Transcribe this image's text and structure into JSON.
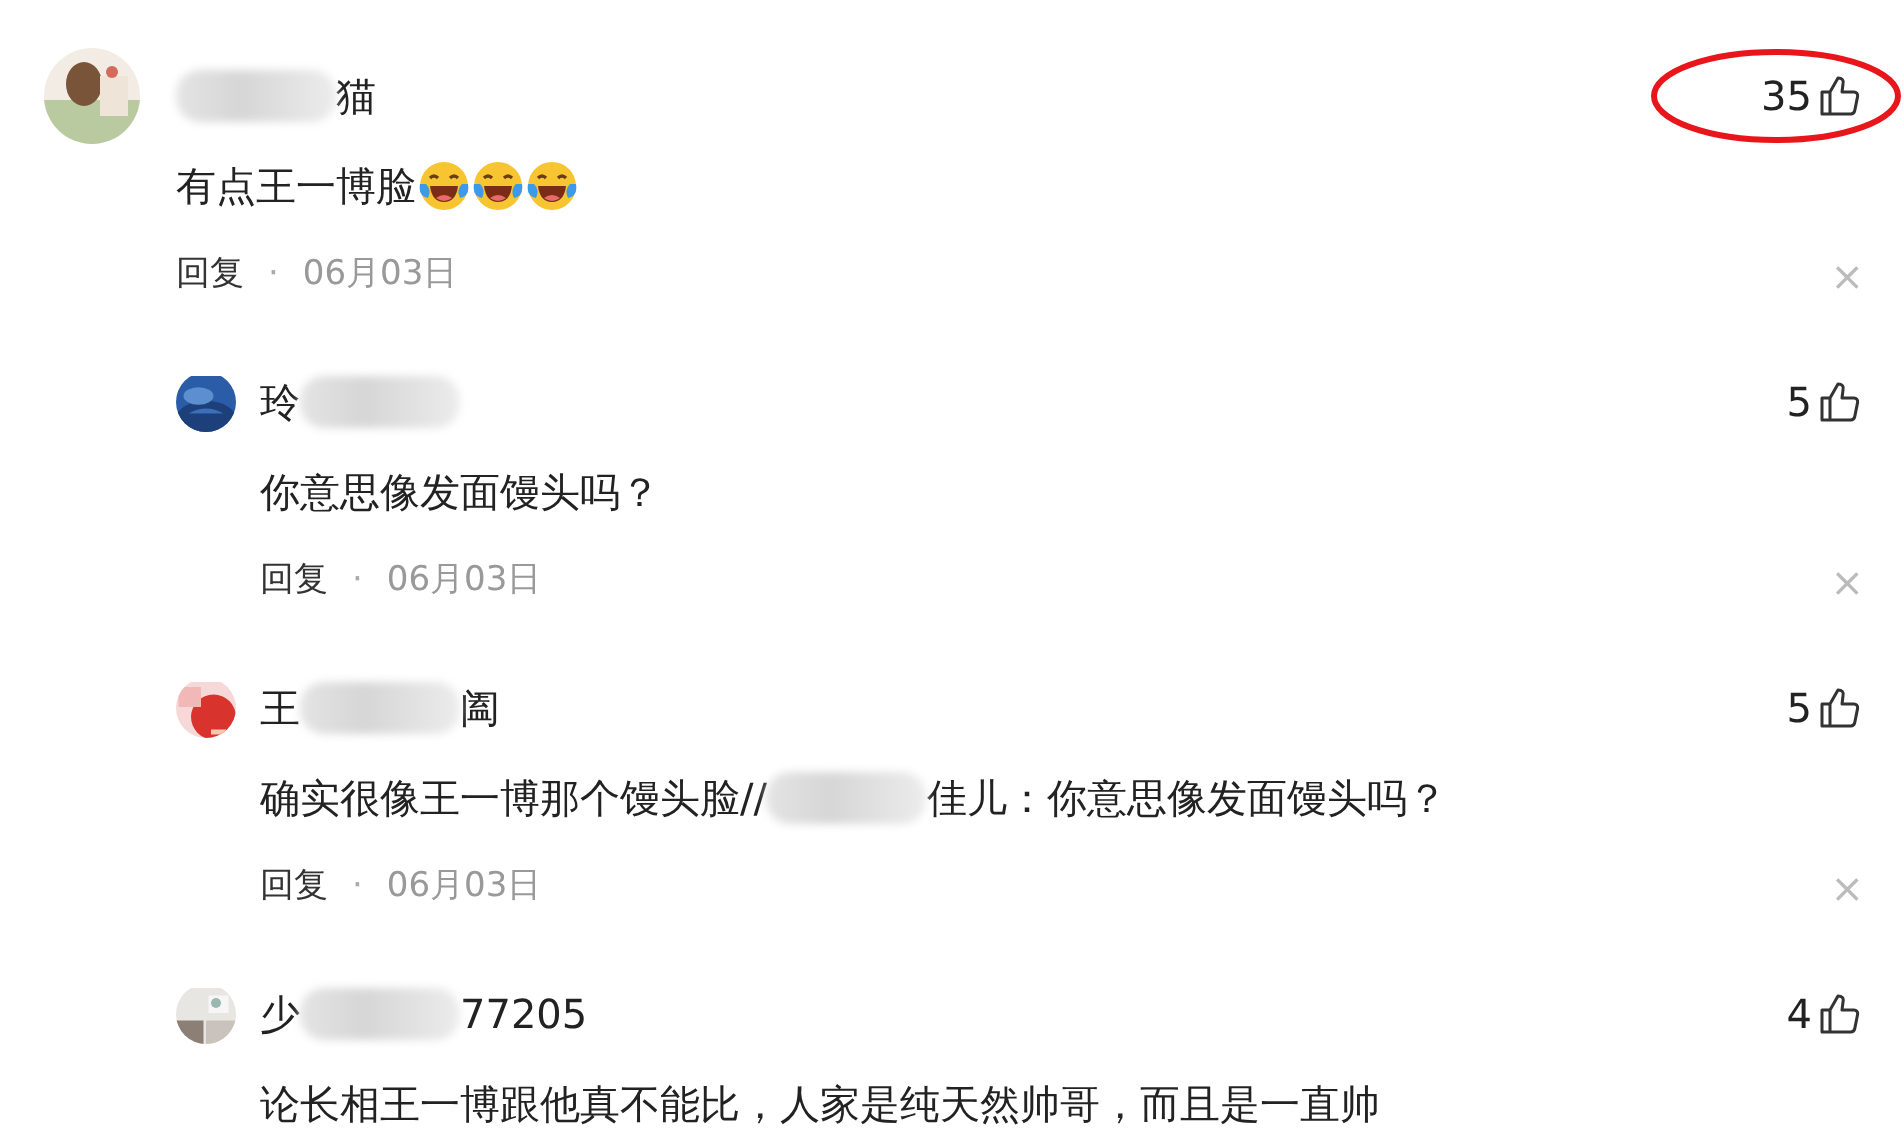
{
  "comments": [
    {
      "name_segments": [
        {
          "kind": "blur"
        },
        {
          "kind": "text",
          "text": "猫"
        }
      ],
      "likes": "35",
      "highlighted": true,
      "body_segments": [
        {
          "kind": "text",
          "text": "有点王一博脸"
        },
        {
          "kind": "emoji"
        },
        {
          "kind": "emoji"
        },
        {
          "kind": "emoji"
        }
      ],
      "reply_label": "回复",
      "separator": "·",
      "date": "06月03日",
      "close": "×",
      "replies": [
        {
          "name_segments": [
            {
              "kind": "text",
              "text": "玲"
            },
            {
              "kind": "blur"
            }
          ],
          "likes": "5",
          "highlighted": false,
          "body_segments": [
            {
              "kind": "text",
              "text": "你意思像发面馒头吗？"
            }
          ],
          "reply_label": "回复",
          "separator": "·",
          "date": "06月03日",
          "close": "×"
        },
        {
          "name_segments": [
            {
              "kind": "text",
              "text": "王"
            },
            {
              "kind": "blur"
            },
            {
              "kind": "text",
              "text": "阖"
            }
          ],
          "likes": "5",
          "highlighted": false,
          "body_segments": [
            {
              "kind": "text",
              "text": "确实很像王一博那个馒头脸//"
            },
            {
              "kind": "blur"
            },
            {
              "kind": "text",
              "text": "佳儿：你意思像发面馒头吗？"
            }
          ],
          "reply_label": "回复",
          "separator": "·",
          "date": "06月03日",
          "close": "×"
        },
        {
          "name_segments": [
            {
              "kind": "text",
              "text": "少"
            },
            {
              "kind": "blur"
            },
            {
              "kind": "text",
              "text": "77205"
            }
          ],
          "likes": "4",
          "highlighted": false,
          "body_segments": [
            {
              "kind": "text",
              "text": "论长相王一博跟他真不能比，人家是纯天然帅哥，而且是一直帅"
            }
          ]
        }
      ]
    }
  ]
}
